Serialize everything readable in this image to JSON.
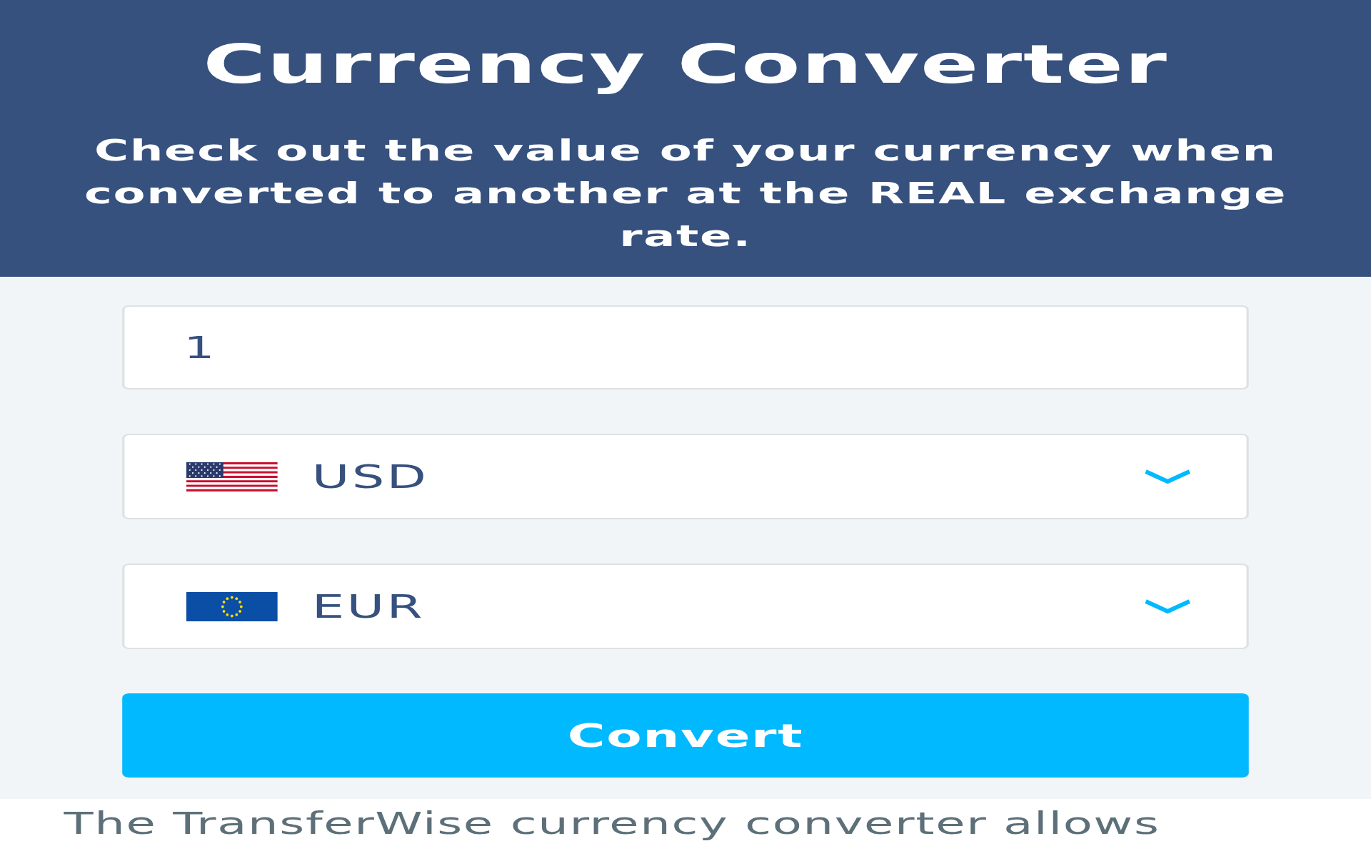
{
  "header": {
    "title": "Currency Converter",
    "subtitle": "Check out the value of your currency when converted to another at the REAL exchange rate."
  },
  "converter": {
    "amount": {
      "value": "1"
    },
    "currencies": [
      {
        "code": "USD",
        "kind": "usa"
      },
      {
        "code": "EUR",
        "kind": "eu"
      }
    ],
    "button": "Convert"
  },
  "intro": {
    "text": "The TransferWise currency converter allows"
  }
}
